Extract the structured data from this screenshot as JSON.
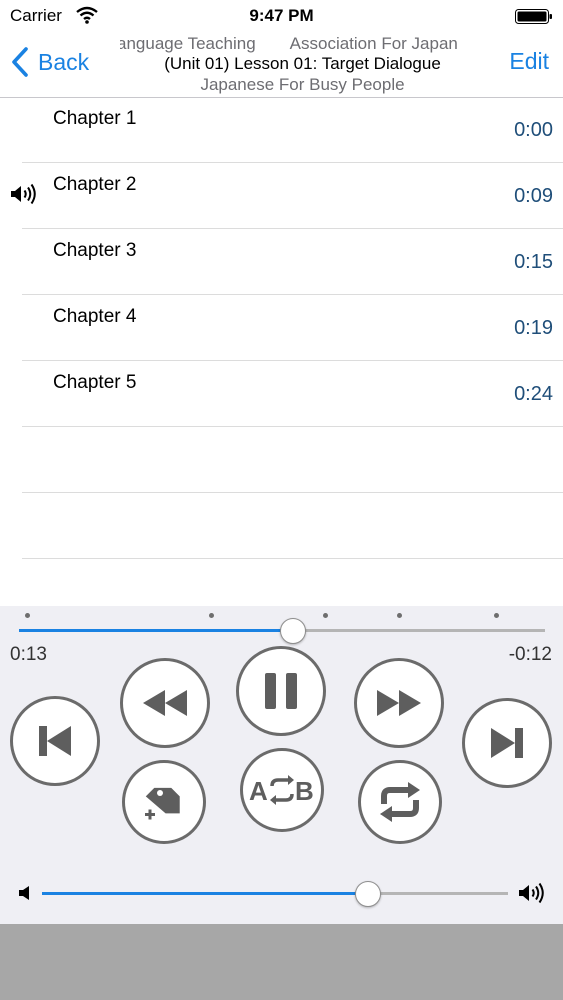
{
  "status": {
    "carrier": "Carrier",
    "time": "9:47 PM"
  },
  "nav": {
    "back_label": "Back",
    "edit_label": "Edit",
    "title_top_left": "anguage Teaching",
    "title_top_right": "Association For Japan",
    "title_main": "(Unit 01) Lesson 01: Target Dialogue",
    "title_sub": "Japanese For Busy People"
  },
  "chapters": [
    {
      "label": "Chapter 1",
      "time": "0:00",
      "playing": false
    },
    {
      "label": "Chapter 2",
      "time": "0:09",
      "playing": true
    },
    {
      "label": "Chapter 3",
      "time": "0:15",
      "playing": false
    },
    {
      "label": "Chapter 4",
      "time": "0:19",
      "playing": false
    },
    {
      "label": "Chapter 5",
      "time": "0:24",
      "playing": false
    }
  ],
  "player": {
    "elapsed": "0:13",
    "remaining": "-0:12",
    "progress_fraction": 0.52,
    "volume_fraction": 0.7,
    "ab_label": "A B",
    "accent_color": "#1a82e2"
  },
  "icons": {
    "playing": "speaker-icon",
    "rewind": "rewind-icon",
    "pause": "pause-icon",
    "forward": "fast-forward-icon",
    "prev": "skip-previous-icon",
    "next": "skip-next-icon",
    "bookmark": "add-tag-icon",
    "ab": "ab-repeat-icon",
    "repeat": "repeat-icon"
  }
}
